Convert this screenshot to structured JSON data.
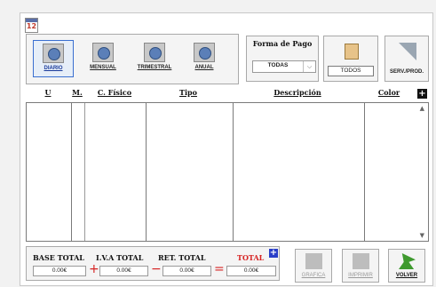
{
  "calendar_icon": {
    "day": "12"
  },
  "period_buttons": [
    {
      "label": "DIARIO",
      "active": true
    },
    {
      "label": "MENSUAL",
      "active": false
    },
    {
      "label": "TRIMESTRAL",
      "active": false
    },
    {
      "label": "ANUAL",
      "active": false
    }
  ],
  "forma_pago": {
    "title": "Forma de Pago",
    "selected": "TODAS",
    "arrow": "⌵"
  },
  "todos_button": {
    "label": "TODOS"
  },
  "serv_button": {
    "label": "SERV./PROD."
  },
  "table": {
    "columns": [
      "U",
      "M.",
      "C. Físico",
      "Tipo",
      "Descripción",
      "Color"
    ],
    "expand_symbol": "+",
    "rows": []
  },
  "totals": {
    "base_label": "BASE TOTAL",
    "iva_label": "I.V.A TOTAL",
    "ret_label": "RET. TOTAL",
    "total_label": "TOTAL",
    "base_value": "0.00€",
    "iva_value": "0.00€",
    "ret_value": "0.00€",
    "total_value": "0.00€",
    "op_plus": "+",
    "op_minus": "−",
    "op_equals": "=",
    "add_symbol": "+"
  },
  "actions": {
    "grafica": "GRAFICA",
    "imprimir": "IMPRIMIR",
    "volver": "VOLVER"
  },
  "colors": {
    "accent_red": "#d62222",
    "accent_blue": "#2a3fc8",
    "active_border": "#3a6fd0"
  }
}
